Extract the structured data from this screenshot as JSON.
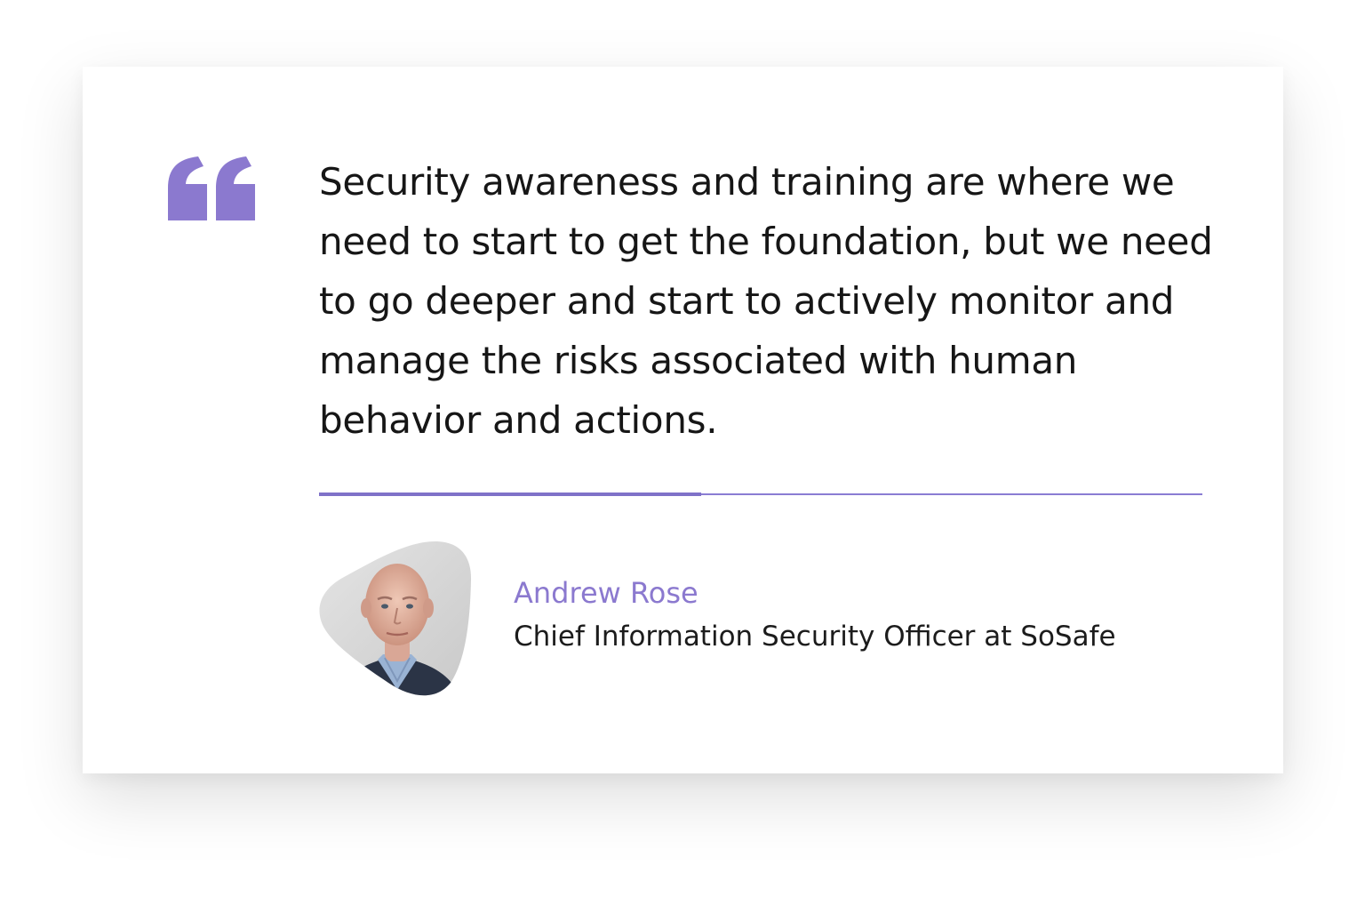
{
  "testimonial": {
    "quote": "Security awareness and training are where we need to start to get the foundation, but we need to go deeper and start to actively monitor and manage the risks associated with human behavior and actions.",
    "author_name": "Andrew Rose",
    "author_role": "Chief Information Security Officer at SoSafe"
  },
  "icons": {
    "quote_mark": "quote-open-icon",
    "avatar": "author-portrait"
  },
  "colors": {
    "accent": "#8b79cf",
    "text": "#161616",
    "background": "#ffffff"
  }
}
